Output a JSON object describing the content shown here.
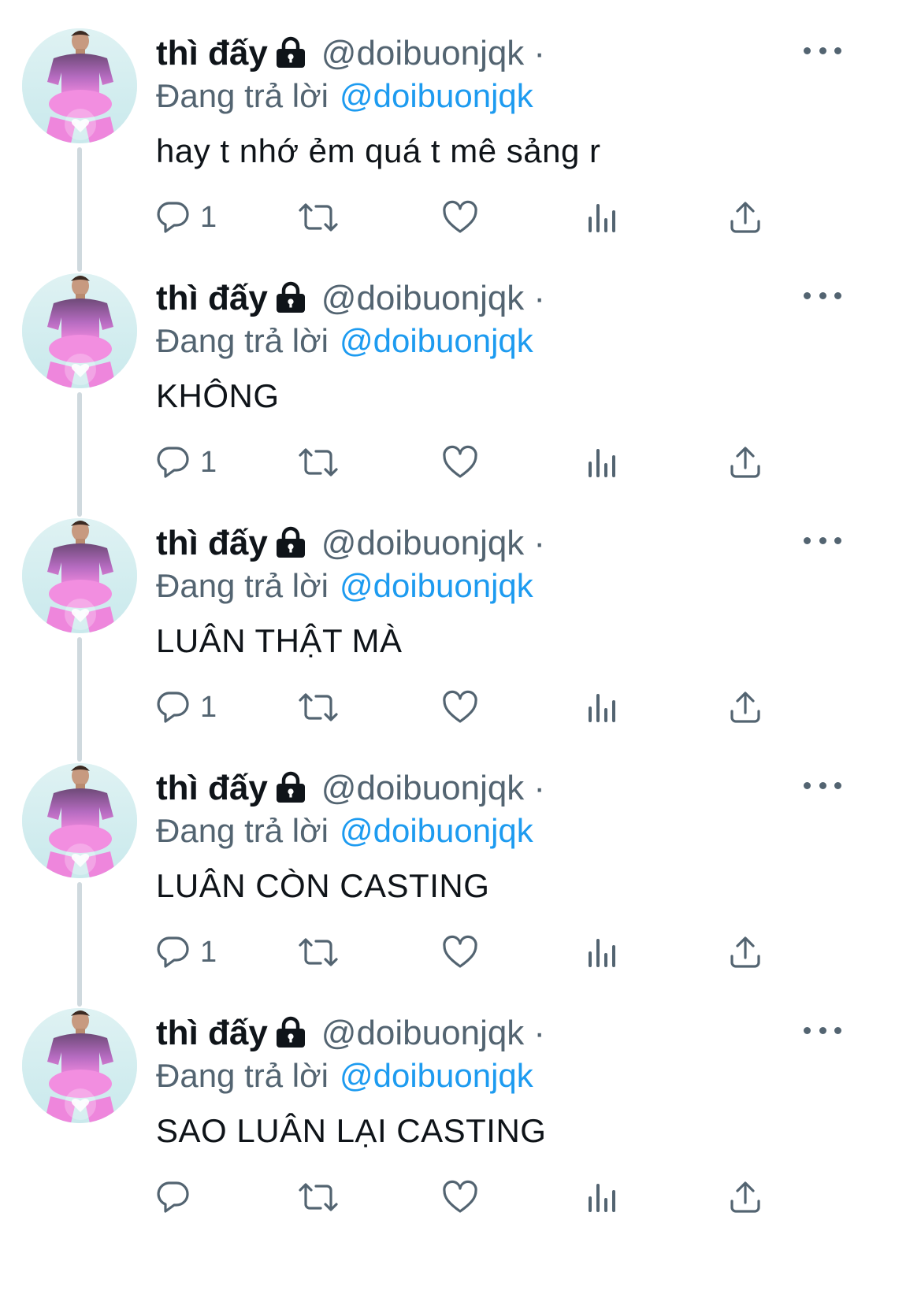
{
  "tweets": [
    {
      "name": "thì đấy",
      "handle": "@doibuonjqk",
      "dot": "·",
      "reply_prefix": "Đang trả lời",
      "reply_to": "@doibuonjqk",
      "text": "hay t nhớ ẻm quá t mê sảng r",
      "reply_count": "1",
      "has_thread_line": true
    },
    {
      "name": "thì đấy",
      "handle": "@doibuonjqk",
      "dot": "·",
      "reply_prefix": "Đang trả lời",
      "reply_to": "@doibuonjqk",
      "text": "KHÔNG",
      "reply_count": "1",
      "has_thread_line": true
    },
    {
      "name": "thì đấy",
      "handle": "@doibuonjqk",
      "dot": "·",
      "reply_prefix": "Đang trả lời",
      "reply_to": "@doibuonjqk",
      "text": "LUÂN THẬT MÀ",
      "reply_count": "1",
      "has_thread_line": true
    },
    {
      "name": "thì đấy",
      "handle": "@doibuonjqk",
      "dot": "·",
      "reply_prefix": "Đang trả lời",
      "reply_to": "@doibuonjqk",
      "text": "LUÂN CÒN CASTING",
      "reply_count": "1",
      "has_thread_line": true
    },
    {
      "name": "thì đấy",
      "handle": "@doibuonjqk",
      "dot": "·",
      "reply_prefix": "Đang trả lời",
      "reply_to": "@doibuonjqk",
      "text": "SAO LUÂN LẠI CASTING",
      "reply_count": "",
      "has_thread_line": false
    }
  ],
  "icons": {
    "protected": "lock-icon",
    "more": "more-options-icon",
    "reply": "reply-icon",
    "retweet": "retweet-icon",
    "like": "heart-icon",
    "analytics": "analytics-icon",
    "share": "share-icon"
  },
  "colors": {
    "text": "#0f1419",
    "secondary": "#536471",
    "link": "#1d9bf0",
    "thread_line": "#cfd9de",
    "avatar_pink": "#e97fd8"
  }
}
